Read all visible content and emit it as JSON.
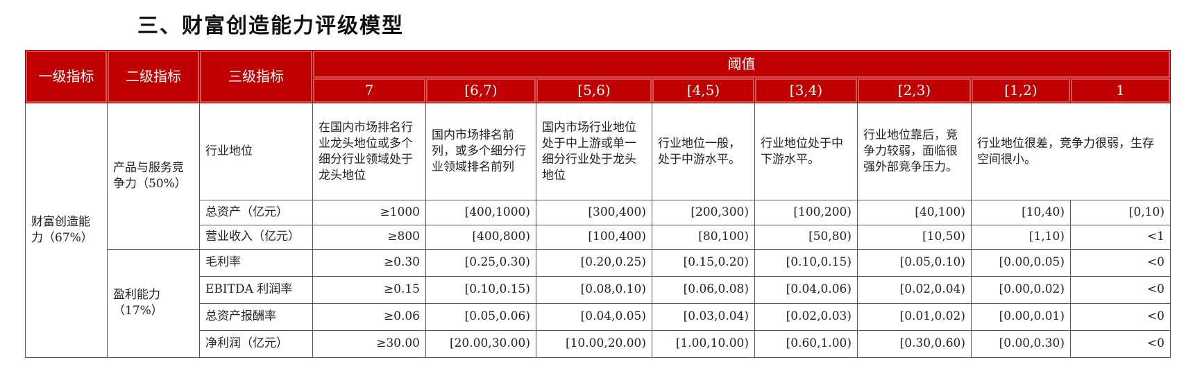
{
  "title": "三、财富创造能力评级模型",
  "table": {
    "headers": {
      "level1": "一级指标",
      "level2": "二级指标",
      "level3": "三级指标",
      "threshold": "阈值",
      "scores": [
        "7",
        "[6,7)",
        "[5,6)",
        "[4,5)",
        "[3,4)",
        "[2,3)",
        "[1,2)",
        "1"
      ]
    },
    "level1_name": "财富创造能力（67%）",
    "groups": [
      {
        "name": "产品与服务竞争力（50%）",
        "rows": [
          {
            "name": "行业地位",
            "cells": [
              "在国内市场排名行业龙头地位或多个细分行业领域处于龙头地位",
              "国内市场排名前列，或多个细分行业领域排名前列",
              "国内市场行业地位处于中上游或单一细分行业处于龙头地位",
              "行业地位一般，处于中游水平。",
              "行业地位处于中下游水平。",
              "行业地位靠后，竞争力较弱，面临很强外部竞争压力。",
              "行业地位很差，竞争力很弱，生存空间很小。"
            ]
          },
          {
            "name": "总资产（亿元）",
            "cells": [
              "≥1000",
              "[400,1000)",
              "[300,400)",
              "[200,300)",
              "[100,200)",
              "[40,100)",
              "[10,40)",
              "[0,10)"
            ]
          },
          {
            "name": "营业收入（亿元）",
            "cells": [
              "≥800",
              "[400,800)",
              "[100,400)",
              "[80,100)",
              "[50,80)",
              "[10,50)",
              "[1,10)",
              "<1"
            ]
          }
        ]
      },
      {
        "name": "盈利能力（17%）",
        "rows": [
          {
            "name": "毛利率",
            "cells": [
              "≥0.30",
              "[0.25,0.30)",
              "[0.20,0.25)",
              "[0.15,0.20)",
              "[0.10,0.15)",
              "[0.05,0.10)",
              "[0.00,0.05)",
              "<0"
            ]
          },
          {
            "name": "EBITDA 利润率",
            "cells": [
              "≥0.15",
              "[0.10,0.15)",
              "[0.08,0.10)",
              "[0.06,0.08)",
              "[0.04,0.06)",
              "[0.02,0.04)",
              "[0.00,0.02)",
              "<0"
            ]
          },
          {
            "name": "总资产报酬率",
            "cells": [
              "≥0.06",
              "[0.05,0.06)",
              "[0.04,0.05)",
              "[0.03,0.04)",
              "[0.02,0.03)",
              "[0.01,0.02)",
              "[0.00,0.01)",
              "<0"
            ]
          },
          {
            "name": "净利润（亿元）",
            "cells": [
              "≥30.00",
              "[20.00,30.00)",
              "[10.00,20.00)",
              "[1.00,10.00)",
              "[0.60,1.00)",
              "[0.30,0.60)",
              "[0.00,0.30)",
              "<0"
            ]
          }
        ]
      }
    ]
  }
}
